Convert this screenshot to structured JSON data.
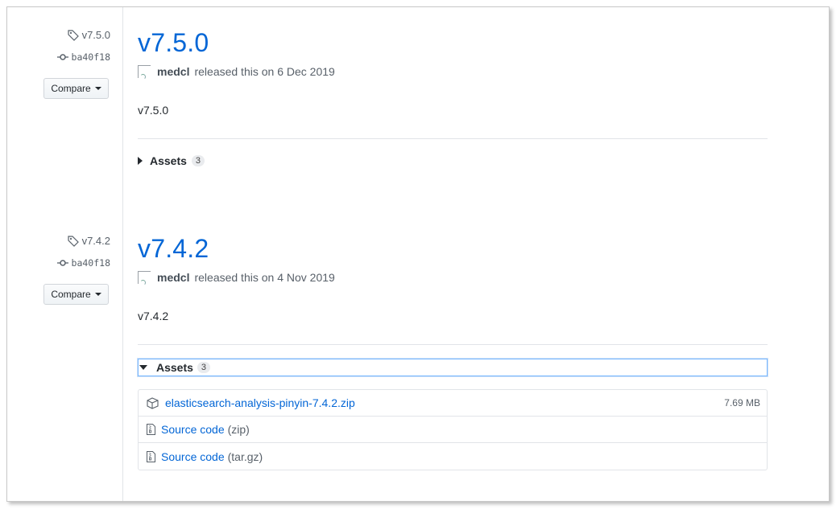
{
  "releases": [
    {
      "tag": "v7.5.0",
      "commit": "ba40f18",
      "compare_label": "Compare",
      "title": "v7.5.0",
      "author": "medcl",
      "released_text": "released this on 6 Dec 2019",
      "description": "v7.5.0",
      "assets_label": "Assets",
      "assets_count": "3"
    },
    {
      "tag": "v7.4.2",
      "commit": "ba40f18",
      "compare_label": "Compare",
      "title": "v7.4.2",
      "author": "medcl",
      "released_text": "released this on 4 Nov 2019",
      "description": "v7.4.2",
      "assets_label": "Assets",
      "assets_count": "3",
      "assets": [
        {
          "name": "elasticsearch-analysis-pinyin-7.4.2.zip",
          "size": "7.69 MB"
        },
        {
          "name": "Source code",
          "ext": "(zip)"
        },
        {
          "name": "Source code",
          "ext": "(tar.gz)"
        }
      ]
    }
  ]
}
